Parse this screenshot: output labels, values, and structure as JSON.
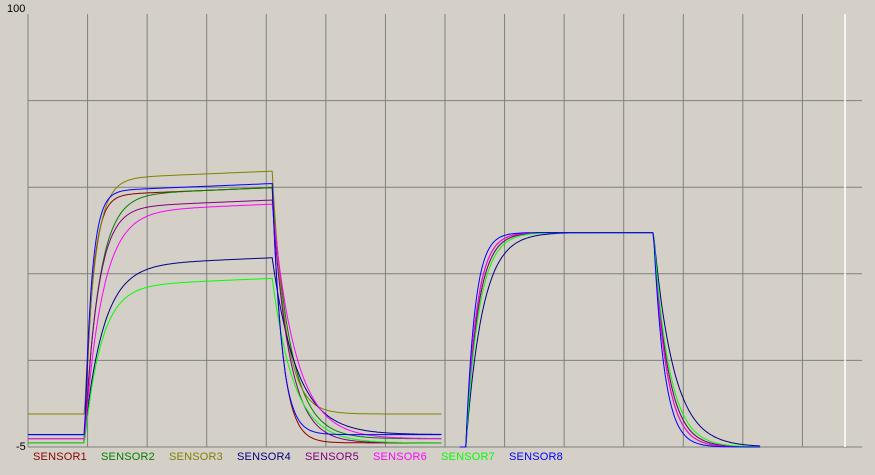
{
  "chart_data": {
    "type": "line",
    "ylim": [
      -5,
      100
    ],
    "y_tick_labels": [
      "100",
      "-5"
    ],
    "grid": true,
    "legend_position": "bottom",
    "xlim": [
      0,
      14
    ],
    "series": [
      {
        "name": "SENSOR1",
        "color": "#8b0000",
        "baseline": -4.0,
        "plateau1": 56,
        "plateau2": 47,
        "tau1": 0.13,
        "tau2": 0.18
      },
      {
        "name": "SENSOR2",
        "color": "#008000",
        "baseline": -3.0,
        "plateau1": 56,
        "plateau2": 47,
        "tau1": 0.24,
        "tau2": 0.2
      },
      {
        "name": "SENSOR3",
        "color": "#808000",
        "baseline": 3.0,
        "plateau1": 60,
        "plateau2": 47,
        "tau1": 0.17,
        "tau2": 0.18
      },
      {
        "name": "SENSOR4",
        "color": "#000080",
        "baseline": -2.0,
        "plateau1": 39,
        "plateau2": 47,
        "tau1": 0.32,
        "tau2": 0.28
      },
      {
        "name": "SENSOR5",
        "color": "#800080",
        "baseline": -4.0,
        "plateau1": 53,
        "plateau2": 47,
        "tau1": 0.22,
        "tau2": 0.2
      },
      {
        "name": "SENSOR6",
        "color": "#ff00ff",
        "baseline": -3.0,
        "plateau1": 52,
        "plateau2": 47,
        "tau1": 0.3,
        "tau2": 0.18
      },
      {
        "name": "SENSOR7",
        "color": "#00ff00",
        "baseline": -4.0,
        "plateau1": 34,
        "plateau2": 47,
        "tau1": 0.28,
        "tau2": 0.22
      },
      {
        "name": "SENSOR8",
        "color": "#0000ff",
        "baseline": -2.0,
        "plateau1": 57,
        "plateau2": 47,
        "tau1": 0.12,
        "tau2": 0.15
      }
    ],
    "pulses": [
      {
        "on": 0.95,
        "off": 4.1,
        "end": 6.95
      },
      {
        "on": 7.35,
        "off": 10.5,
        "end": 12.3
      }
    ]
  }
}
